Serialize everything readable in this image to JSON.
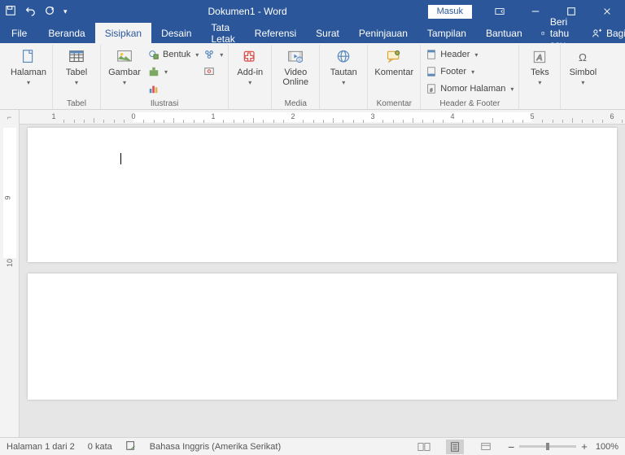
{
  "titlebar": {
    "title": "Dokumen1  -  Word",
    "signin": "Masuk"
  },
  "menu": {
    "file": "File",
    "tabs": [
      "Beranda",
      "Sisipkan",
      "Desain",
      "Tata Letak",
      "Referensi",
      "Surat",
      "Peninjauan",
      "Tampilan",
      "Bantuan"
    ],
    "active_index": 1,
    "tellme": "Beri tahu say",
    "share": "Bagikan"
  },
  "ribbon": {
    "halaman": {
      "label": "Halaman",
      "group": "Tabel",
      "btn": "Halaman"
    },
    "tabel": {
      "btn": "Tabel",
      "group": "Tabel"
    },
    "ilustrasi": {
      "gambar": "Gambar",
      "bentuk": "Bentuk",
      "group": "Ilustrasi"
    },
    "addin": {
      "btn": "Add-in",
      "group": ""
    },
    "media": {
      "btn": "Video Online",
      "group": "Media"
    },
    "tautan": {
      "btn": "Tautan",
      "group": ""
    },
    "komentar": {
      "btn": "Komentar",
      "group": "Komentar"
    },
    "headerfooter": {
      "header": "Header",
      "footer": "Footer",
      "nomor": "Nomor Halaman",
      "group": "Header & Footer"
    },
    "teks": {
      "btn": "Teks",
      "group": ""
    },
    "simbol": {
      "btn": "Simbol",
      "group": ""
    }
  },
  "status": {
    "page": "Halaman 1 dari 2",
    "words": "0 kata",
    "lang": "Bahasa Inggris (Amerika Serikat)",
    "zoom": "100%"
  }
}
